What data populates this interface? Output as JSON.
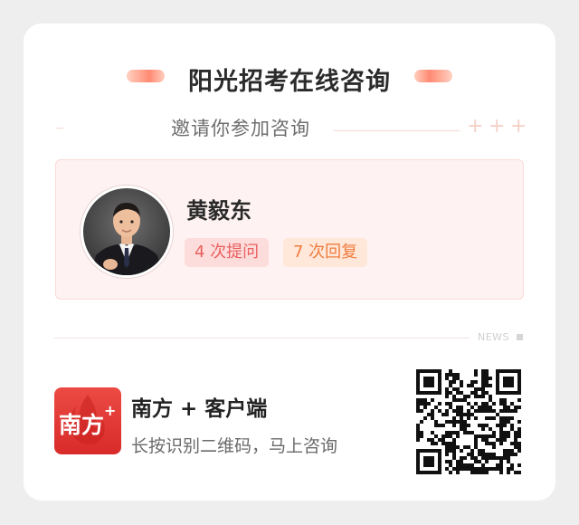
{
  "header": {
    "title": "阳光招考在线咨询",
    "subtitle": "邀请你参加咨询",
    "decor_plus": "+ + +"
  },
  "profile": {
    "name": "黄毅东",
    "questions_label": "4 次提问",
    "replies_label": "7 次回复"
  },
  "divider": {
    "label": "NEWS"
  },
  "app": {
    "name": "南方 + 客户端",
    "hint": "长按识别二维码，马上咨询",
    "logo_text": "南方",
    "logo_plus": "+"
  },
  "colors": {
    "accent_red": "#e8615f",
    "accent_orange": "#ef7d3e",
    "logo_red": "#e23a36",
    "profile_bg": "#fff2f2"
  },
  "icons": {
    "qr": "qr-code-icon",
    "logo": "nanfang-plus-logo"
  }
}
